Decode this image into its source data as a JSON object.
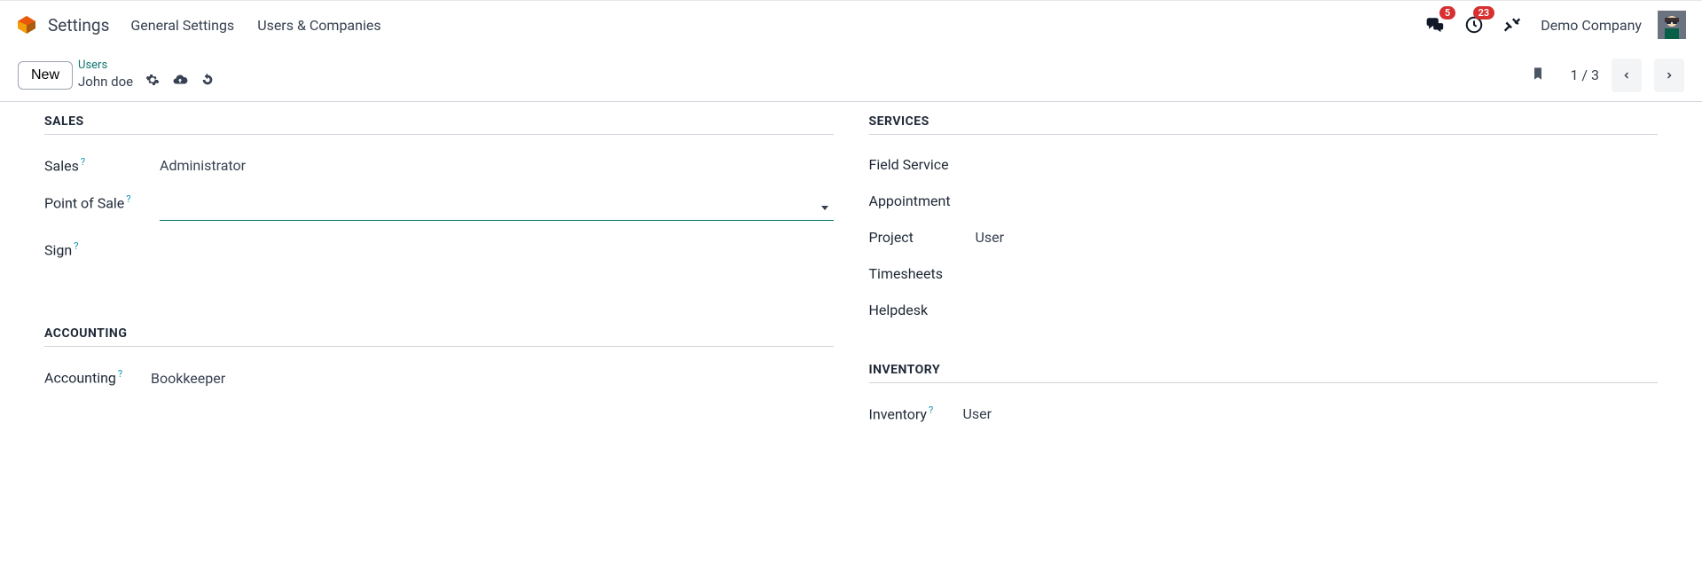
{
  "header": {
    "app": "Settings",
    "nav": [
      "General Settings",
      "Users & Companies"
    ],
    "messages_badge": "5",
    "activities_badge": "23",
    "company": "Demo Company"
  },
  "subheader": {
    "new_label": "New",
    "breadcrumb_parent": "Users",
    "breadcrumb_current": "John doe",
    "page": "1 / 3"
  },
  "sections": {
    "sales": {
      "title": "SALES",
      "fields": {
        "sales": {
          "label": "Sales",
          "value": "Administrator"
        },
        "point_of_sale": {
          "label": "Point of Sale",
          "value": ""
        },
        "sign": {
          "label": "Sign",
          "value": ""
        }
      }
    },
    "services": {
      "title": "SERVICES",
      "fields": {
        "field_service": {
          "label": "Field Service",
          "value": ""
        },
        "appointment": {
          "label": "Appointment",
          "value": ""
        },
        "project": {
          "label": "Project",
          "value": "User"
        },
        "timesheets": {
          "label": "Timesheets",
          "value": ""
        },
        "helpdesk": {
          "label": "Helpdesk",
          "value": ""
        }
      }
    },
    "accounting": {
      "title": "ACCOUNTING",
      "fields": {
        "accounting": {
          "label": "Accounting",
          "value": "Bookkeeper"
        }
      }
    },
    "inventory": {
      "title": "INVENTORY",
      "fields": {
        "inventory": {
          "label": "Inventory",
          "value": "User"
        }
      }
    }
  }
}
